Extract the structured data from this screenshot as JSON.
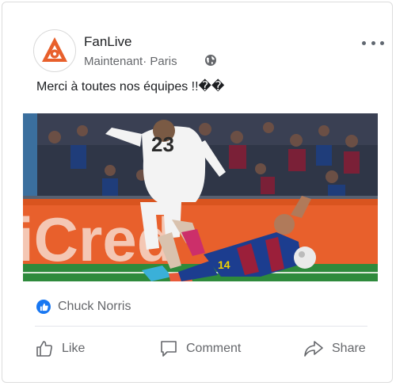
{
  "post": {
    "page_name": "FanLive",
    "timestamp": "Maintenant",
    "location": "Paris",
    "text": "Merci à toutes nos équipes !!��"
  },
  "photo": {
    "banner_text": "iCred",
    "player_number": "23",
    "player2_number": "14"
  },
  "reactions": {
    "icon": "thumbs-up-icon",
    "name": "Chuck Norris"
  },
  "actions": {
    "like": "Like",
    "comment": "Comment",
    "share": "Share"
  },
  "colors": {
    "brand_orange": "#e8602c",
    "like_blue": "#1877f2",
    "secondary_text": "#65676b"
  }
}
